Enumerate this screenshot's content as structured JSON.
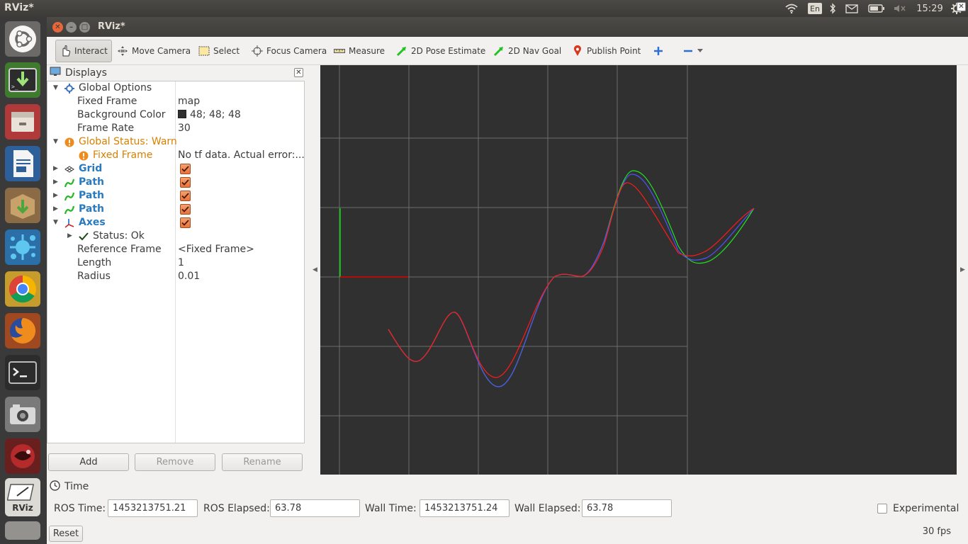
{
  "system_bar": {
    "app_title": "RViz*",
    "language": "En",
    "clock": "15:29",
    "icons": [
      "wifi-icon",
      "bluetooth-icon",
      "mail-icon",
      "battery-icon",
      "volume-mute-icon",
      "settings-gear-icon"
    ]
  },
  "launcher": {
    "items": [
      "ubuntu-dash-icon",
      "install-terminal-icon",
      "files-icon",
      "writer-icon",
      "archive-installer-icon",
      "paint-splash-icon",
      "chrome-icon",
      "firefox-icon",
      "terminal-icon",
      "camera-icon",
      "ros-turtle-icon",
      "rviz-icon"
    ],
    "rviz_label": "RViz"
  },
  "window": {
    "title": "RViz*"
  },
  "toolbar": {
    "tools": [
      {
        "label": "Interact",
        "icon": "hand-pointer-icon",
        "active": true
      },
      {
        "label": "Move Camera",
        "icon": "move-camera-icon"
      },
      {
        "label": "Select",
        "icon": "select-box-icon"
      },
      {
        "label": "Focus Camera",
        "icon": "focus-target-icon"
      },
      {
        "label": "Measure",
        "icon": "ruler-icon"
      },
      {
        "label": "2D Pose Estimate",
        "icon": "green-arrow-icon"
      },
      {
        "label": "2D Nav Goal",
        "icon": "green-arrow-icon"
      },
      {
        "label": "Publish Point",
        "icon": "map-pin-icon"
      }
    ],
    "add_tool_icon": "plus-icon",
    "remove_tool_icon": "minus-icon"
  },
  "displays": {
    "title": "Displays",
    "tree": {
      "global_options": "Global Options",
      "fixed_frame_label": "Fixed Frame",
      "fixed_frame_value": "map",
      "background_color_label": "Background Color",
      "background_color_value": "48; 48; 48",
      "background_color_hex": "#303030",
      "frame_rate_label": "Frame Rate",
      "frame_rate_value": "30",
      "global_status": "Global Status: Warn",
      "status_fixed_frame": "Fixed Frame",
      "status_fixed_frame_value": "No tf data.  Actual error:...",
      "grid": "Grid",
      "path1": "Path",
      "path2": "Path",
      "path3": "Path",
      "axes": "Axes",
      "status_ok": "Status: Ok",
      "reference_frame_label": "Reference Frame",
      "reference_frame_value": "<Fixed Frame>",
      "length_label": "Length",
      "length_value": "1",
      "radius_label": "Radius",
      "radius_value": "0.01"
    },
    "buttons": {
      "add": "Add",
      "remove": "Remove",
      "rename": "Rename"
    }
  },
  "viewport": {
    "background": "#303030",
    "path_colors": [
      "#00ff00",
      "#3c3cff",
      "#ff0000"
    ]
  },
  "time": {
    "title": "Time",
    "ros_time_label": "ROS Time:",
    "ros_time_value": "1453213751.21",
    "ros_elapsed_label": "ROS Elapsed:",
    "ros_elapsed_value": "63.78",
    "wall_time_label": "Wall Time:",
    "wall_time_value": "1453213751.24",
    "wall_elapsed_label": "Wall Elapsed:",
    "wall_elapsed_value": "63.78",
    "experimental_label": "Experimental",
    "experimental_checked": false,
    "reset_label": "Reset",
    "fps": "30 fps"
  }
}
